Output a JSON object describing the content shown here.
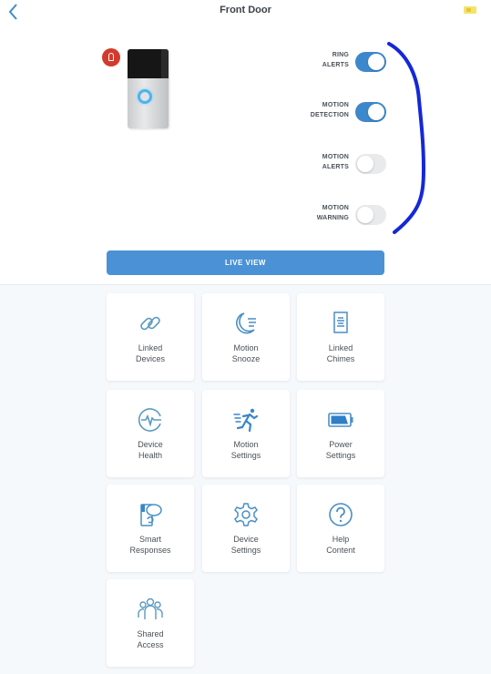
{
  "header": {
    "title": "Front Door",
    "back_icon": "chevron-left-icon",
    "battery_icon": "battery-low-icon"
  },
  "device": {
    "image": "doorbell-device-image",
    "badge_icon": "privacy-lock-icon",
    "badge_color": "#d23a2e"
  },
  "toggles": [
    {
      "label": "RING\nALERTS",
      "on": true
    },
    {
      "label": "MOTION\nDETECTION",
      "on": true
    },
    {
      "label": "MOTION\nALERTS",
      "on": false
    },
    {
      "label": "MOTION\nWARNING",
      "on": false
    }
  ],
  "live_view": {
    "label": "LIVE VIEW",
    "color": "#4a92d5"
  },
  "tiles": [
    {
      "label": "Linked\nDevices",
      "icon": "link-icon"
    },
    {
      "label": "Motion\nSnooze",
      "icon": "moon-snooze-icon"
    },
    {
      "label": "Linked\nChimes",
      "icon": "chime-icon"
    },
    {
      "label": "Device\nHealth",
      "icon": "heartbeat-icon"
    },
    {
      "label": "Motion\nSettings",
      "icon": "running-person-icon"
    },
    {
      "label": "Power\nSettings",
      "icon": "battery-icon"
    },
    {
      "label": "Smart\nResponses",
      "icon": "chat-bubble-icon"
    },
    {
      "label": "Device\nSettings",
      "icon": "gear-icon"
    },
    {
      "label": "Help\nContent",
      "icon": "question-icon"
    },
    {
      "label": "Shared\nAccess",
      "icon": "users-icon"
    }
  ],
  "annotation": {
    "type": "bracket",
    "color": "#1428d8"
  }
}
